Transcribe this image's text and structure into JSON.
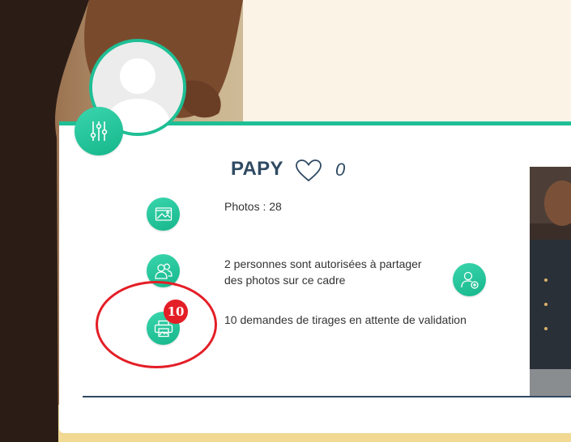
{
  "profile": {
    "name": "PAPY",
    "likes_count": "0"
  },
  "info": {
    "photos_text": "Photos : 28",
    "shared_text_line1": "2 personnes sont autorisées à partager",
    "shared_text_line2": "des photos sur ce cadre",
    "requests_text": "10 demandes de tirages en attente de validation",
    "requests_badge": "10"
  },
  "icons": {
    "settings": "settings-sliders-icon",
    "photos": "image-icon",
    "users": "users-icon",
    "add_user": "add-user-icon",
    "print": "printer-icon",
    "heart": "heart-icon"
  },
  "colors": {
    "accent": "#1fbf95",
    "name_text": "#2f4a63",
    "badge": "#e41e26",
    "highlight": "#e41e26"
  }
}
